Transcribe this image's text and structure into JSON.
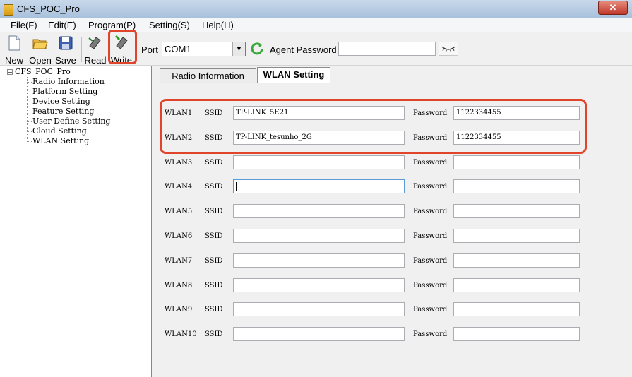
{
  "window": {
    "title": "CFS_POC_Pro"
  },
  "menu": [
    "File(F)",
    "Edit(E)",
    "Program(P)",
    "Setting(S)",
    "Help(H)"
  ],
  "toolbar": {
    "new_label": "New",
    "open_label": "Open",
    "save_label": "Save",
    "read_label": "Read",
    "write_label": "Write",
    "port_label": "Port",
    "port_value": "COM1",
    "agent_password_label": "Agent Password",
    "agent_password_value": ""
  },
  "tree": {
    "root": "CFS_POC_Pro",
    "items": [
      "Radio Information",
      "Platform Setting",
      "Device Setting",
      "Feature Setting",
      "User Define Setting",
      "Cloud Setting",
      "WLAN Setting"
    ]
  },
  "tabs": [
    {
      "label": "Radio Information",
      "active": false
    },
    {
      "label": "WLAN Setting",
      "active": true
    }
  ],
  "wlan": {
    "ssid_label": "SSID",
    "password_label": "Password",
    "rows": [
      {
        "name": "WLAN1",
        "ssid": "TP-LINK_5E21",
        "password": "1122334455"
      },
      {
        "name": "WLAN2",
        "ssid": "TP-LINK_tesunho_2G",
        "password": "1122334455"
      },
      {
        "name": "WLAN3",
        "ssid": "",
        "password": ""
      },
      {
        "name": "WLAN4",
        "ssid": "",
        "password": ""
      },
      {
        "name": "WLAN5",
        "ssid": "",
        "password": ""
      },
      {
        "name": "WLAN6",
        "ssid": "",
        "password": ""
      },
      {
        "name": "WLAN7",
        "ssid": "",
        "password": ""
      },
      {
        "name": "WLAN8",
        "ssid": "",
        "password": ""
      },
      {
        "name": "WLAN9",
        "ssid": "",
        "password": ""
      },
      {
        "name": "WLAN10",
        "ssid": "",
        "password": ""
      }
    ]
  },
  "colors": {
    "highlight": "#e0442a",
    "focus_border": "#5b9bd5"
  }
}
